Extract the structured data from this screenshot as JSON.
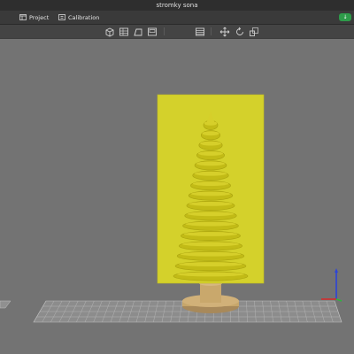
{
  "window": {
    "title": "stromky sona"
  },
  "menu": {
    "project_label": "Project",
    "calibration_label": "Calibration",
    "sync_badge_glyph": "↓"
  },
  "toolbar": {
    "icons": [
      "cube-view-icon",
      "grid-view-icon",
      "layout-view-icon",
      "table-icon",
      "move-icon",
      "rotate-icon",
      "scale-icon"
    ]
  },
  "colors": {
    "viewport_bg": "#737373",
    "model": "#c8c21a",
    "support_block": "#d9d92e",
    "base": "#c7a66a",
    "build_plate": "#a9a9a9",
    "sync_green": "#2e9b4a"
  }
}
